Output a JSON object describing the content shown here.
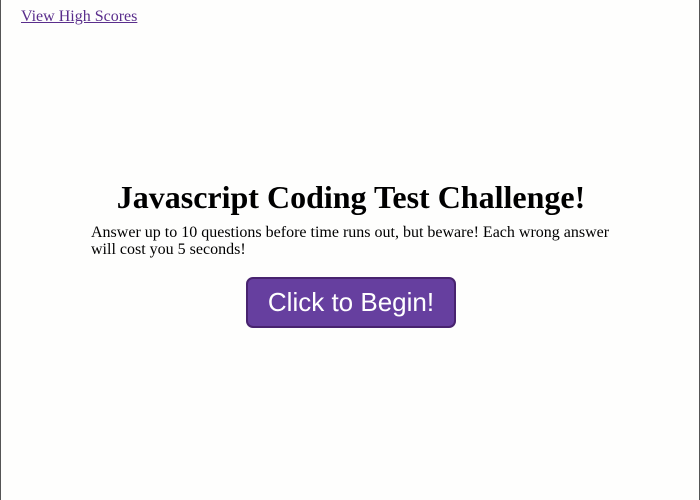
{
  "nav": {
    "high_scores_label": "View High Scores"
  },
  "main": {
    "title": "Javascript Coding Test Challenge!",
    "instructions": "Answer up to 10 questions before time runs out, but beware! Each wrong answer will cost you 5 seconds!",
    "start_button_label": "Click to Begin!"
  },
  "colors": {
    "link": "#5a2e8c",
    "button_background": "#663f9f",
    "button_border": "#48236f",
    "button_text": "#ffffff",
    "page_background": "#fefefd"
  }
}
